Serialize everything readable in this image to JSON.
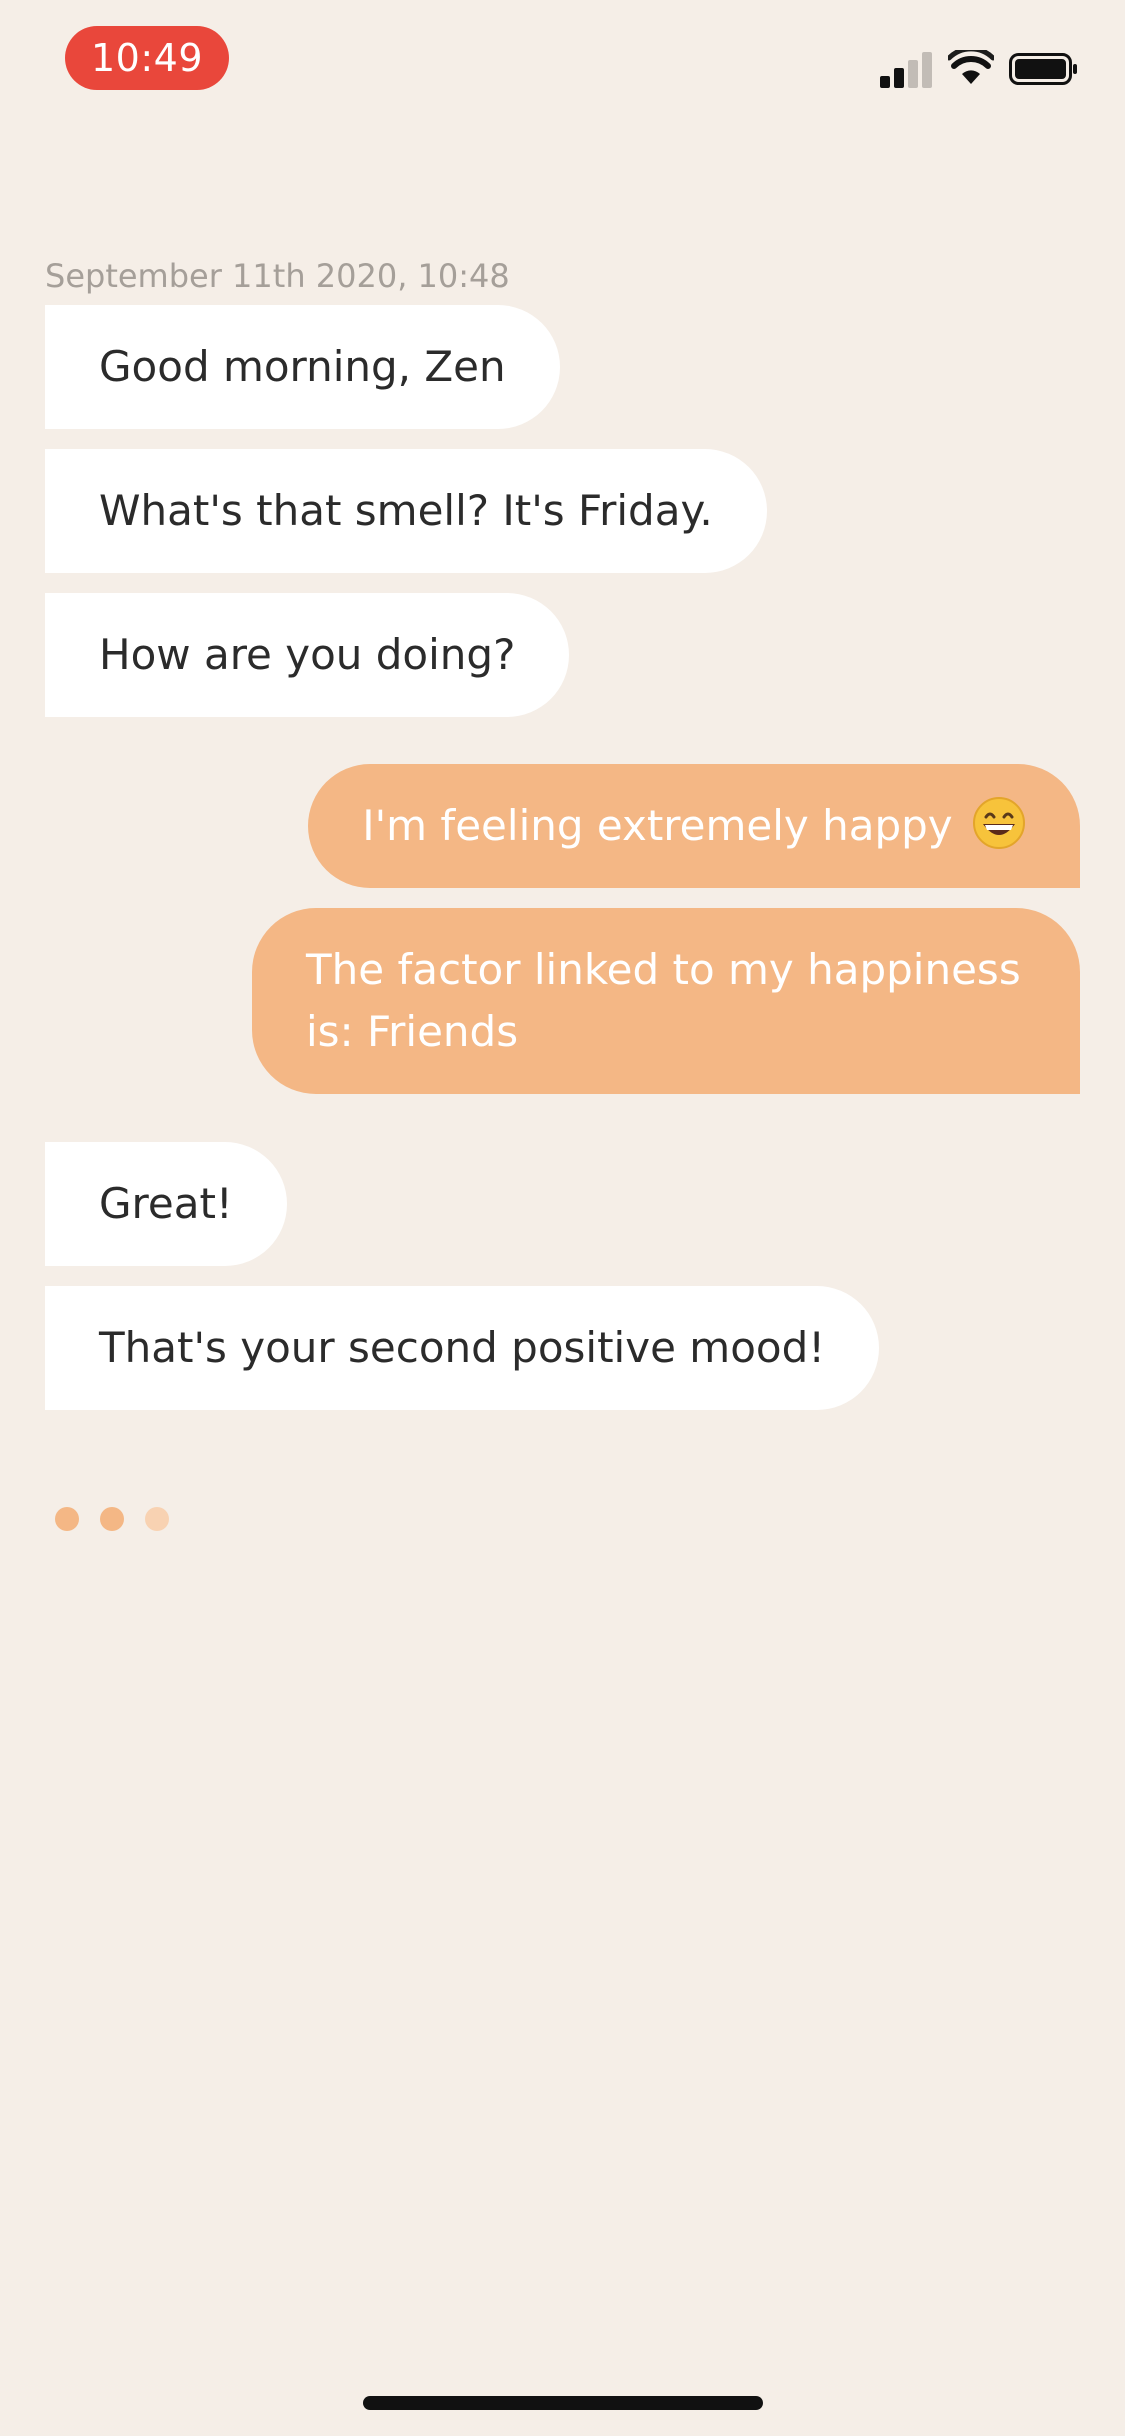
{
  "status_bar": {
    "time": "10:49",
    "time_pill_color": "#e9473b",
    "icons": [
      "cellular-signal-icon",
      "wifi-icon",
      "battery-icon"
    ]
  },
  "chat": {
    "timestamp": "September 11th 2020, 10:48",
    "messages": [
      {
        "from": "bot",
        "text": "Good morning, Zen"
      },
      {
        "from": "bot",
        "text": "What's that smell? It's Friday."
      },
      {
        "from": "bot",
        "text": "How are you doing?"
      },
      {
        "from": "user",
        "text": "I'm feeling extremely happy",
        "emoji": "grinning-face-icon"
      },
      {
        "from": "user",
        "text": "The factor linked to my happiness is: Friends"
      },
      {
        "from": "bot",
        "text": "Great!"
      },
      {
        "from": "bot",
        "text": "That's your second positive mood!"
      }
    ],
    "typing_indicator": true
  },
  "colors": {
    "background": "#f5eee7",
    "bot_bubble": "#ffffff",
    "user_bubble": "#f4b785",
    "accent": "#f4b785"
  }
}
